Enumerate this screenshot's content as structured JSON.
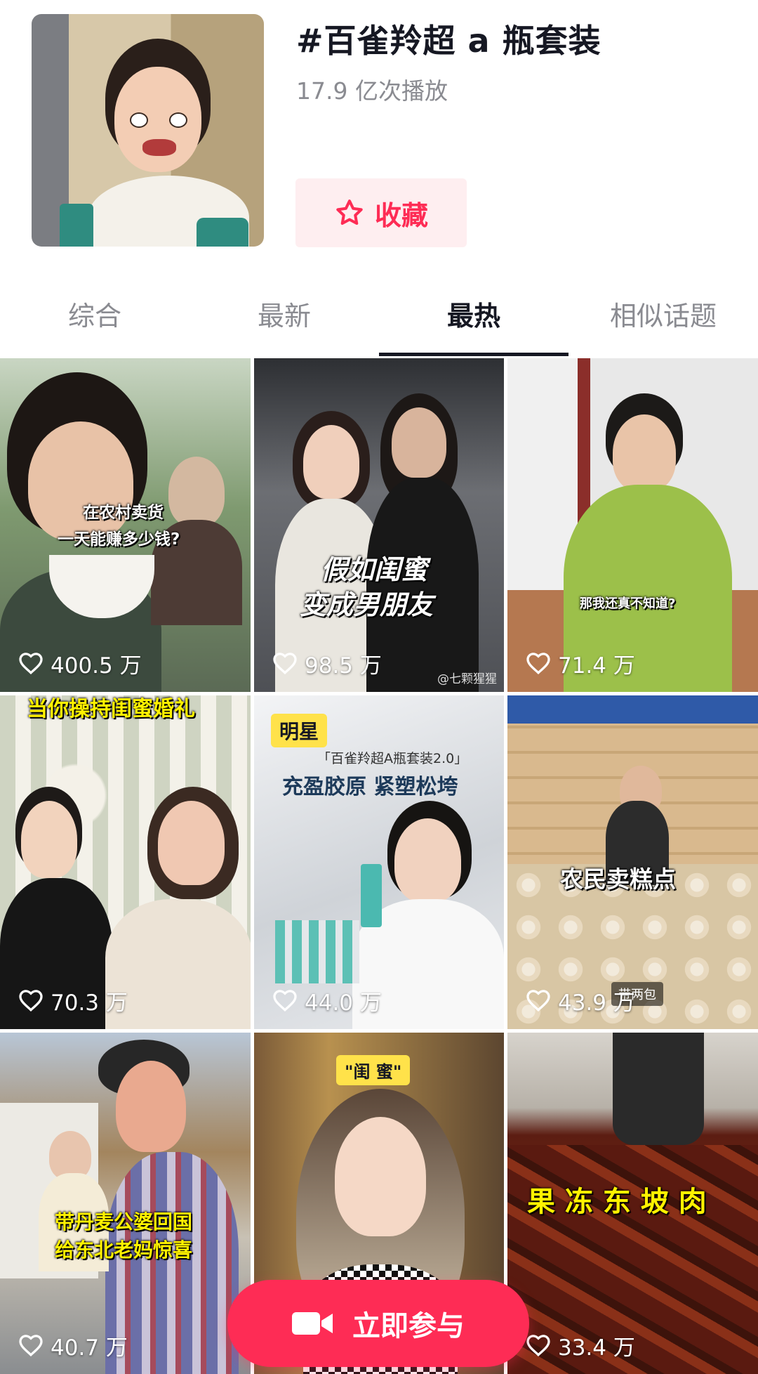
{
  "header": {
    "topic_title": "#百雀羚超 a 瓶套装",
    "play_count": "17.9 亿次播放",
    "favorite_label": "收藏"
  },
  "tabs": [
    "综合",
    "最新",
    "最热",
    "相似话题"
  ],
  "active_tab": "最热",
  "videos": [
    {
      "likes": "400.5 万",
      "caption_lines": [
        "在农村卖货",
        "一天能赚多少钱?"
      ]
    },
    {
      "likes": "98.5 万",
      "caption_lines": [
        "假如闺蜜",
        "变成男朋友"
      ],
      "watermark": "@七颗猩猩"
    },
    {
      "likes": "71.4 万",
      "caption_lines": [
        "那我还真不知道?"
      ]
    },
    {
      "likes": "70.3 万",
      "caption_lines": [
        "当你操持闺蜜婚礼"
      ]
    },
    {
      "likes": "44.0 万",
      "badge": "明星",
      "caption_lines": [
        "「百雀羚超A瓶套装2.0」",
        "充盈胶原 紧塑松垮"
      ]
    },
    {
      "likes": "43.9 万",
      "caption_lines": [
        "农民卖糕点"
      ],
      "small_label": "带两包"
    },
    {
      "likes": "40.7 万",
      "caption_lines": [
        "带丹麦公婆回国",
        "给东北老妈惊喜"
      ]
    },
    {
      "likes": "",
      "badge": "\"闺 蜜\"",
      "caption_lines": []
    },
    {
      "likes": "33.4 万",
      "caption_lines": [
        "果 冻 东 坡 肉"
      ]
    }
  ],
  "cta": {
    "label": "立即参与"
  },
  "colors": {
    "accent": "#fe2c55",
    "accent_light": "#feeef0",
    "text_primary": "#161823",
    "text_secondary": "#8a8b91",
    "caption_yellow": "#fff200"
  }
}
